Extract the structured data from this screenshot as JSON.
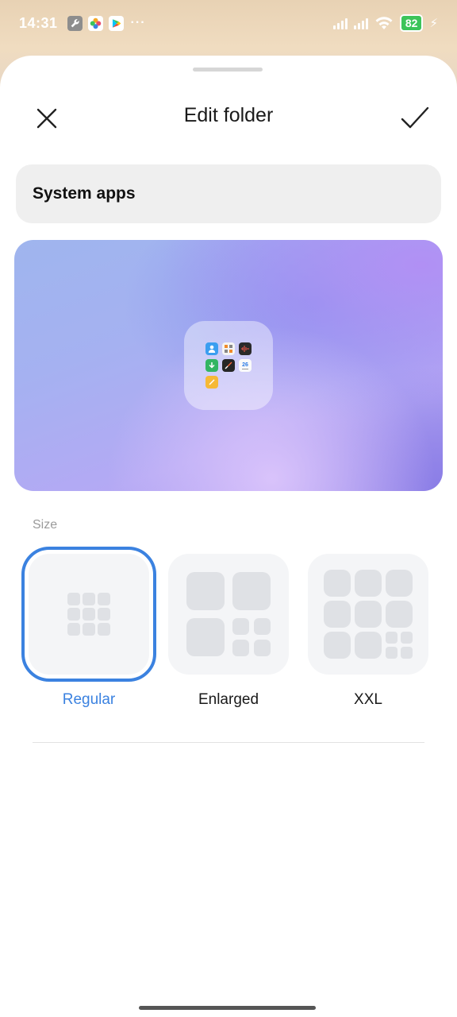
{
  "status_bar": {
    "time": "14:31",
    "app_icons": [
      "wrench-icon",
      "color-flower-icon",
      "play-store-icon"
    ],
    "more": "···",
    "battery": "82",
    "battery_color": "#3cc45a"
  },
  "header": {
    "title": "Edit folder",
    "close_icon": "close-icon",
    "confirm_icon": "checkmark-icon"
  },
  "folder_name": {
    "value": "System apps"
  },
  "preview": {
    "folder_apps": [
      "contacts-icon",
      "calculator-icon",
      "sound-recorder-icon",
      "downloads-icon",
      "compass-icon",
      "calendar-icon",
      "notes-icon"
    ],
    "calendar_day": "26"
  },
  "size": {
    "label": "Size",
    "options": [
      {
        "label": "Regular",
        "selected": true
      },
      {
        "label": "Enlarged",
        "selected": false
      },
      {
        "label": "XXL",
        "selected": false
      }
    ],
    "accent_color": "#3b82e0"
  }
}
